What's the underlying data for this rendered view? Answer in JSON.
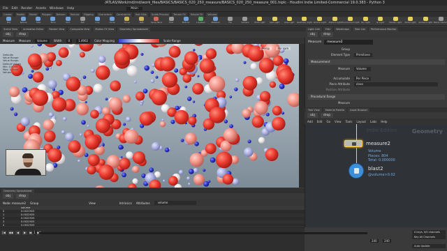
{
  "app": {
    "title": "/ATLAS/Work/rnd/rnd/work_files/BASICS/BASICS_020_250_measure/BASICS_020_250_measure_001.hiplc - Houdini Indie Limited-Commercial 19.0.383 - Python 3"
  },
  "menu": [
    "File",
    "Edit",
    "Render",
    "Assets",
    "Windows",
    "Help"
  ],
  "desktop": "Main",
  "shelf_tabs": [
    "Create",
    "Modify",
    "Model",
    "Polygon",
    "Deform",
    "Texture",
    "Rigging",
    "Characters",
    "Constraints",
    "Hair Utils",
    "Guide Process",
    "Terrain FX",
    "Simple FX",
    "Volume"
  ],
  "shelf_tools": [
    {
      "label": "Box",
      "color": "#6fa0d8"
    },
    {
      "label": "Sphere",
      "color": "#6fa0d8"
    },
    {
      "label": "Tube",
      "color": "#6fa0d8"
    },
    {
      "label": "Torus",
      "color": "#6fa0d8"
    },
    {
      "label": "Grid",
      "color": "#6fa0d8"
    },
    {
      "label": "Null",
      "color": "#9a9a9a"
    },
    {
      "label": "Line",
      "color": "#6fa0d8"
    },
    {
      "label": "Circle",
      "color": "#6fa0d8"
    },
    {
      "label": "Curve",
      "color": "#c9b25a"
    },
    {
      "label": "Path",
      "color": "#c9b25a"
    },
    {
      "label": "Spray Paint",
      "color": "#c96a5a"
    },
    {
      "label": "Font",
      "color": "#9a9a9a"
    },
    {
      "label": "Platonic",
      "color": "#6fa0d8"
    },
    {
      "label": "L-System",
      "color": "#5ab06a"
    },
    {
      "label": "Metaball",
      "color": "#6fa0d8"
    },
    {
      "label": "File",
      "color": "#9a9a9a"
    },
    {
      "label": "Camera",
      "color": "#9a9a9a"
    },
    {
      "label": "Point Light",
      "color": "#e2d060"
    },
    {
      "label": "Spot Light",
      "color": "#e2d060"
    },
    {
      "label": "Area Light",
      "color": "#e2d060"
    },
    {
      "label": "Geometry Light",
      "color": "#e2d060"
    },
    {
      "label": "Volume Light",
      "color": "#e2d060"
    },
    {
      "label": "Distant Light",
      "color": "#e2d060"
    },
    {
      "label": "Environment Light",
      "color": "#e2d060"
    },
    {
      "label": "Sky Light",
      "color": "#e2d060"
    },
    {
      "label": "GI Light",
      "color": "#e2d060"
    },
    {
      "label": "Caustic Light",
      "color": "#e2d060"
    },
    {
      "label": "Portal Light",
      "color": "#e2d060"
    },
    {
      "label": "Ambient Light",
      "color": "#e2d060"
    },
    {
      "label": "Stereo Camera",
      "color": "#9a9a9a"
    }
  ],
  "left_tabs": [
    "Scene View",
    "Animation Editor",
    "Render View",
    "Composite View",
    "Motion FX View",
    "Geometry Spreadsheet"
  ],
  "viewport_path": [
    "obj",
    "drop"
  ],
  "viewport_bar": {
    "node": "Measure",
    "mode_label": "Measure",
    "mode": "Volume",
    "width_label": "Width",
    "width": "0",
    "max": "1.4902",
    "color_mapping_label": "Color Mapping",
    "scale_label": "Scale Range"
  },
  "viewport": {
    "legend": [
      "Defaults",
      "Value Range",
      "Value Range",
      "Default Values",
      "Min: 0.0000",
      "Max: 1.5000",
      "Values"
    ],
    "persp": "Persp",
    "cam": "No cam"
  },
  "sheet_tabs": [
    "Geometry Spreadsheet"
  ],
  "sheet_path": [
    "obj",
    "drop"
  ],
  "sheet_bar": {
    "node_label": "Node: measure2",
    "group_label": "Group",
    "view_label": "View",
    "intrinsics_label": "Intrinsics",
    "attributes_label": "Attributes",
    "attributes_value": "volume"
  },
  "sheet": {
    "columns": [
      "",
      "volume"
    ],
    "rows": [
      [
        "0",
        "0.0022925"
      ],
      [
        "1",
        "0.0022925"
      ],
      [
        "2",
        "0.0022925"
      ],
      [
        "3",
        "0.0022925"
      ],
      [
        "4",
        "0.0022925"
      ]
    ]
  },
  "timeline": {
    "frame": "1",
    "end_frame": "240",
    "end_frame2": "240",
    "keys_label": "0 keys, 0/0 channels",
    "channels_label": "Key All Channels",
    "auto_label": "Auto Update",
    "buttons": [
      "|◀",
      "◀◀",
      "◀",
      "▶",
      "▶▶",
      "▶|"
    ]
  },
  "param_tabs": [
    "Light Link",
    "Hier",
    "Wordmaps",
    "Take List",
    "Performance Monitor"
  ],
  "param_path": [
    "obj",
    "drop"
  ],
  "params": {
    "node_type": "Measure",
    "node_name": "measure2",
    "fields": [
      {
        "label": "Group",
        "value": ""
      },
      {
        "label": "Element Type",
        "value": "Primitives"
      },
      {
        "label": "Measure",
        "value": "Volume"
      },
      {
        "label": "Accumulate",
        "value": "Per Piece"
      },
      {
        "label": "Piece Attribute",
        "value": "class"
      },
      {
        "label": "Position Attribute",
        "value": ""
      }
    ],
    "section_label": "Measurement",
    "section2_label": "Procedural Range",
    "output_label": "Measure"
  },
  "net_tabs": [
    "Tree View",
    "Material Palette",
    "Asset Browser"
  ],
  "net_path": [
    "obj",
    "drop"
  ],
  "net_menu": [
    "Add",
    "Edit",
    "Go",
    "View",
    "Tools",
    "Layout",
    "Labs",
    "Help"
  ],
  "network": {
    "context": "Geometry",
    "ghost_label": "Indie Edition",
    "measure_name": "measure2",
    "measure_info": [
      "Volume",
      "Pieces: 804",
      "Total: 0.000000"
    ],
    "blast_name": "blast2",
    "blast_expr": "@volume>0.02"
  },
  "colors": {
    "red": "#e8372c",
    "blue": "#2a33c8",
    "white": "#f2f2f2",
    "selected_node": "#ffcf40"
  }
}
